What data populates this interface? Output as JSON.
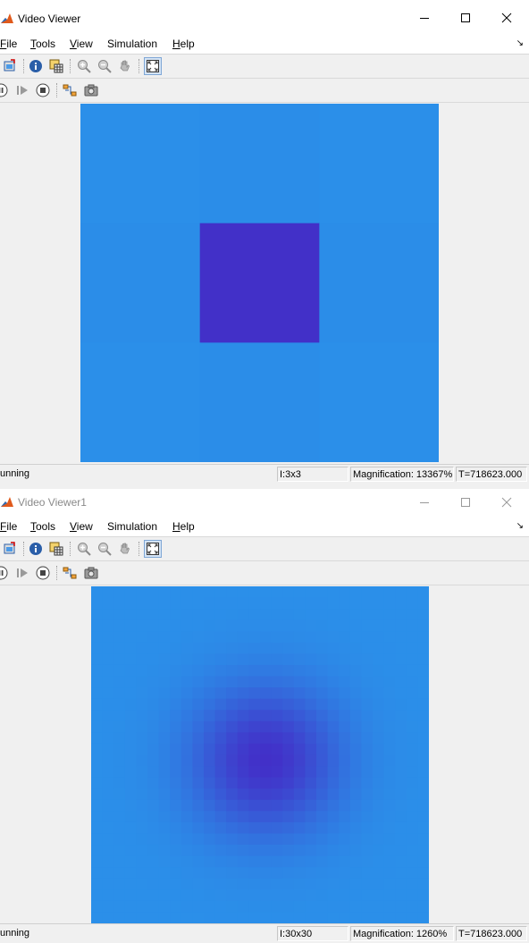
{
  "viewers": [
    {
      "title": "Video Viewer",
      "menu": [
        {
          "accel": "F",
          "rest": "ile"
        },
        {
          "accel": "T",
          "rest": "ools"
        },
        {
          "accel": "V",
          "rest": "iew"
        },
        {
          "accel": "",
          "rest": "Simulation",
          "ul_index": 1
        },
        {
          "accel": "H",
          "rest": "elp"
        }
      ],
      "status": {
        "state": "unning",
        "dims": "I:3x3",
        "magnification": "Magnification: 13367%",
        "time": "T=718623.000"
      },
      "image": {
        "background": "#2b8fe9",
        "center_color": "#4230c8"
      }
    },
    {
      "title": "Video Viewer1",
      "menu": [
        {
          "accel": "F",
          "rest": "ile"
        },
        {
          "accel": "T",
          "rest": "ools"
        },
        {
          "accel": "V",
          "rest": "iew"
        },
        {
          "accel": "",
          "rest": "Simulation",
          "ul_index": 1
        },
        {
          "accel": "H",
          "rest": "elp"
        }
      ],
      "status": {
        "state": "unning",
        "dims": "I:30x30",
        "magnification": "Magnification: 1260%",
        "time": "T=718623.000"
      },
      "image": {
        "background": "#2b8fe9",
        "center_color": "#4230c8"
      }
    }
  ],
  "icons": {
    "app": "matlab-icon",
    "minimize": "minimize-icon",
    "maximize": "maximize-icon",
    "close": "close-icon",
    "dock": "dock-arrow-icon",
    "toolbar1": [
      "new-viewer-icon",
      "info-icon",
      "pixel-region-icon",
      "zoom-in-icon",
      "zoom-out-icon",
      "pan-icon",
      "fit-to-view-icon"
    ],
    "toolbar2": [
      "pause-icon",
      "step-forward-icon",
      "stop-icon",
      "highlight-simulink-icon",
      "snapshot-icon"
    ]
  }
}
